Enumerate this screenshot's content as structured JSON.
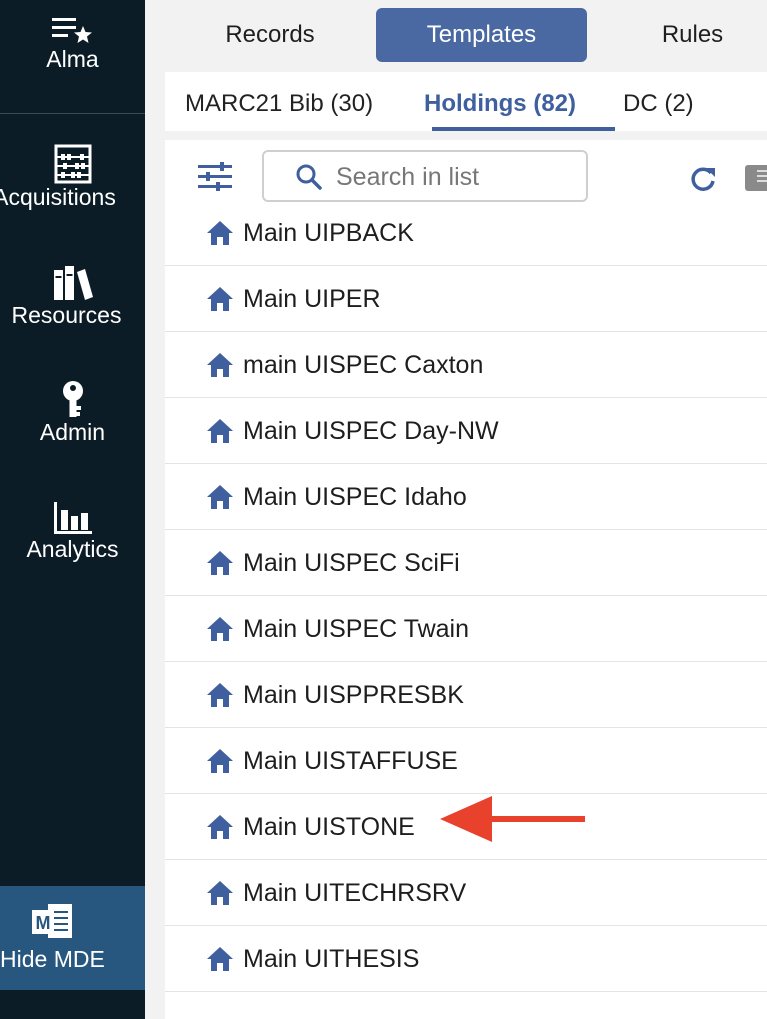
{
  "sidebar": {
    "items": [
      {
        "label": "Alma",
        "icon": "alma-menu-icon"
      },
      {
        "label": "Acquisitions",
        "icon": "abacus-icon"
      },
      {
        "label": "Resources",
        "icon": "books-icon"
      },
      {
        "label": "Admin",
        "icon": "key-icon"
      },
      {
        "label": "Analytics",
        "icon": "bar-chart-icon"
      }
    ],
    "hide_mde": {
      "label": "Hide MDE",
      "icon": "mde-icon"
    }
  },
  "top_tabs": [
    {
      "label": "Records",
      "active": false
    },
    {
      "label": "Templates",
      "active": true
    },
    {
      "label": "Rules",
      "active": false
    }
  ],
  "sub_tabs": [
    {
      "label": "MARC21 Bib (30)",
      "active": false
    },
    {
      "label": "Holdings (82)",
      "active": true
    },
    {
      "label": "DC (2)",
      "active": false
    }
  ],
  "toolbar": {
    "search_placeholder": "Search in list",
    "filter_icon": "sliders-icon",
    "refresh_icon": "refresh-icon"
  },
  "list": {
    "items": [
      "Main UIPBACK",
      "Main UIPER",
      "main UISPEC Caxton",
      "Main UISPEC Day-NW",
      "Main UISPEC Idaho",
      "Main UISPEC SciFi",
      "Main UISPEC Twain",
      "Main UISPPRESBK",
      "Main UISTAFFUSE",
      "Main UISTONE",
      "Main UITECHRSRV",
      "Main UITHESIS"
    ]
  },
  "colors": {
    "sidebar_bg": "#0c1c27",
    "accent": "#4a69a3",
    "hide_mde_bg": "#27577f",
    "arrow": "#e8412c"
  }
}
